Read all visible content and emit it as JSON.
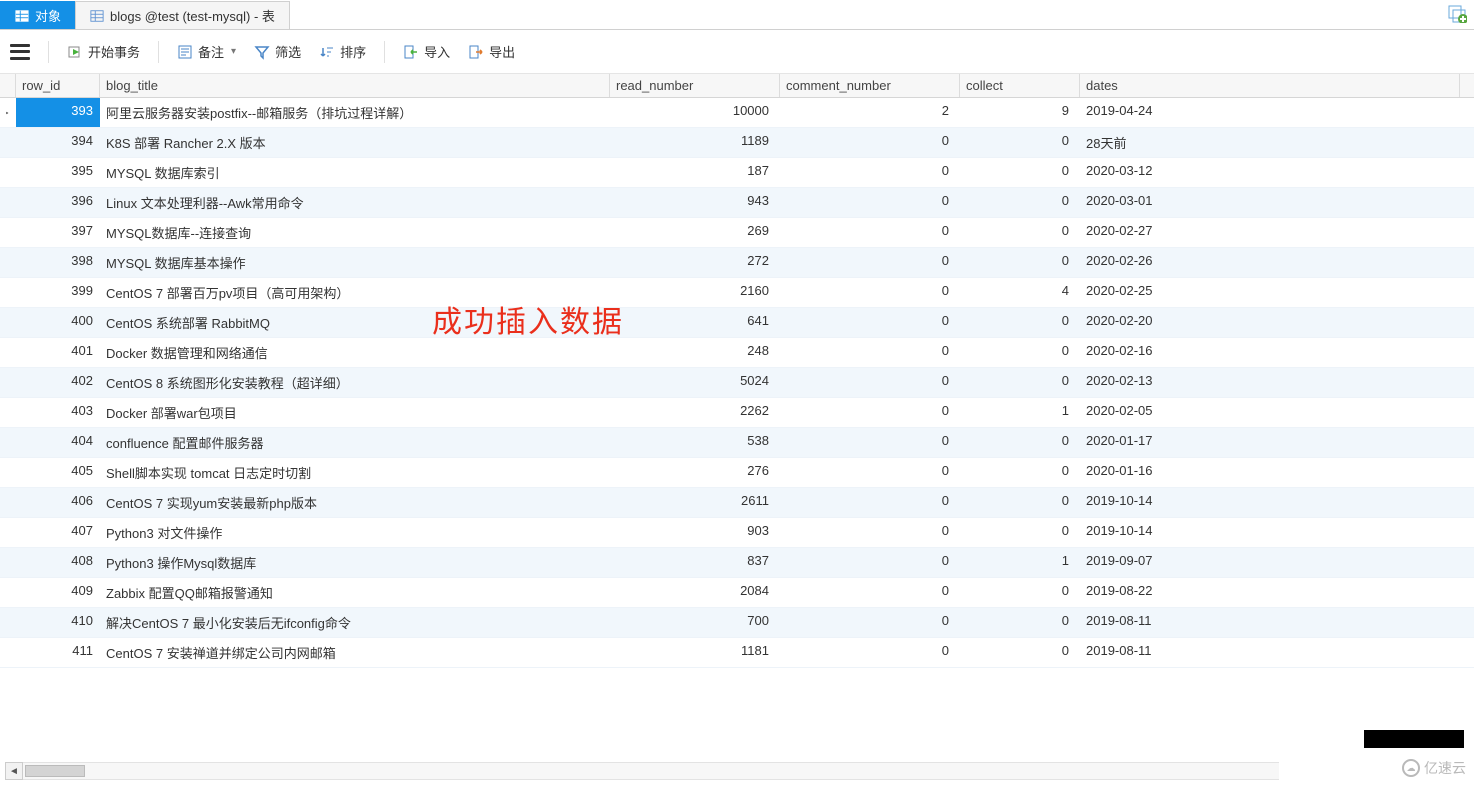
{
  "tabs": {
    "object_label": "对象",
    "table_tab_label": "blogs @test (test-mysql) - 表"
  },
  "toolbar": {
    "begin_tx": "开始事务",
    "remark": "备注",
    "filter": "筛选",
    "sort": "排序",
    "import": "导入",
    "export": "导出"
  },
  "columns": {
    "row_id": "row_id",
    "blog_title": "blog_title",
    "read_number": "read_number",
    "comment_number": "comment_number",
    "collect": "collect",
    "dates": "dates"
  },
  "overlay": "成功插入数据",
  "rows": [
    {
      "row_id": 393,
      "blog_title": "阿里云服务器安装postfix--邮箱服务（排坑过程详解）",
      "read_number": 10000,
      "comment_number": 2,
      "collect": 9,
      "dates": "2019-04-24",
      "selected": true
    },
    {
      "row_id": 394,
      "blog_title": "K8S 部署 Rancher 2.X 版本",
      "read_number": 1189,
      "comment_number": 0,
      "collect": 0,
      "dates": "28天前"
    },
    {
      "row_id": 395,
      "blog_title": "MYSQL 数据库索引",
      "read_number": 187,
      "comment_number": 0,
      "collect": 0,
      "dates": "2020-03-12"
    },
    {
      "row_id": 396,
      "blog_title": "Linux 文本处理利器--Awk常用命令",
      "read_number": 943,
      "comment_number": 0,
      "collect": 0,
      "dates": "2020-03-01"
    },
    {
      "row_id": 397,
      "blog_title": "MYSQL数据库--连接查询",
      "read_number": 269,
      "comment_number": 0,
      "collect": 0,
      "dates": "2020-02-27"
    },
    {
      "row_id": 398,
      "blog_title": "MYSQL 数据库基本操作",
      "read_number": 272,
      "comment_number": 0,
      "collect": 0,
      "dates": "2020-02-26"
    },
    {
      "row_id": 399,
      "blog_title": "CentOS 7 部署百万pv项目（高可用架构）",
      "read_number": 2160,
      "comment_number": 0,
      "collect": 4,
      "dates": "2020-02-25"
    },
    {
      "row_id": 400,
      "blog_title": "CentOS 系统部署 RabbitMQ",
      "read_number": 641,
      "comment_number": 0,
      "collect": 0,
      "dates": "2020-02-20"
    },
    {
      "row_id": 401,
      "blog_title": "Docker 数据管理和网络通信",
      "read_number": 248,
      "comment_number": 0,
      "collect": 0,
      "dates": "2020-02-16"
    },
    {
      "row_id": 402,
      "blog_title": "CentOS 8 系统图形化安装教程（超详细）",
      "read_number": 5024,
      "comment_number": 0,
      "collect": 0,
      "dates": "2020-02-13"
    },
    {
      "row_id": 403,
      "blog_title": "Docker 部署war包项目",
      "read_number": 2262,
      "comment_number": 0,
      "collect": 1,
      "dates": "2020-02-05"
    },
    {
      "row_id": 404,
      "blog_title": "confluence 配置邮件服务器",
      "read_number": 538,
      "comment_number": 0,
      "collect": 0,
      "dates": "2020-01-17"
    },
    {
      "row_id": 405,
      "blog_title": "Shell脚本实现 tomcat 日志定时切割",
      "read_number": 276,
      "comment_number": 0,
      "collect": 0,
      "dates": "2020-01-16"
    },
    {
      "row_id": 406,
      "blog_title": "CentOS 7 实现yum安装最新php版本",
      "read_number": 2611,
      "comment_number": 0,
      "collect": 0,
      "dates": "2019-10-14"
    },
    {
      "row_id": 407,
      "blog_title": "Python3 对文件操作",
      "read_number": 903,
      "comment_number": 0,
      "collect": 0,
      "dates": "2019-10-14"
    },
    {
      "row_id": 408,
      "blog_title": "Python3 操作Mysql数据库",
      "read_number": 837,
      "comment_number": 0,
      "collect": 1,
      "dates": "2019-09-07"
    },
    {
      "row_id": 409,
      "blog_title": "Zabbix 配置QQ邮箱报警通知",
      "read_number": 2084,
      "comment_number": 0,
      "collect": 0,
      "dates": "2019-08-22"
    },
    {
      "row_id": 410,
      "blog_title": "解决CentOS 7 最小化安装后无ifconfig命令",
      "read_number": 700,
      "comment_number": 0,
      "collect": 0,
      "dates": "2019-08-11"
    },
    {
      "row_id": 411,
      "blog_title": "CentOS 7 安装禅道并绑定公司内网邮箱",
      "read_number": 1181,
      "comment_number": 0,
      "collect": 0,
      "dates": "2019-08-11"
    }
  ],
  "watermark": "亿速云"
}
